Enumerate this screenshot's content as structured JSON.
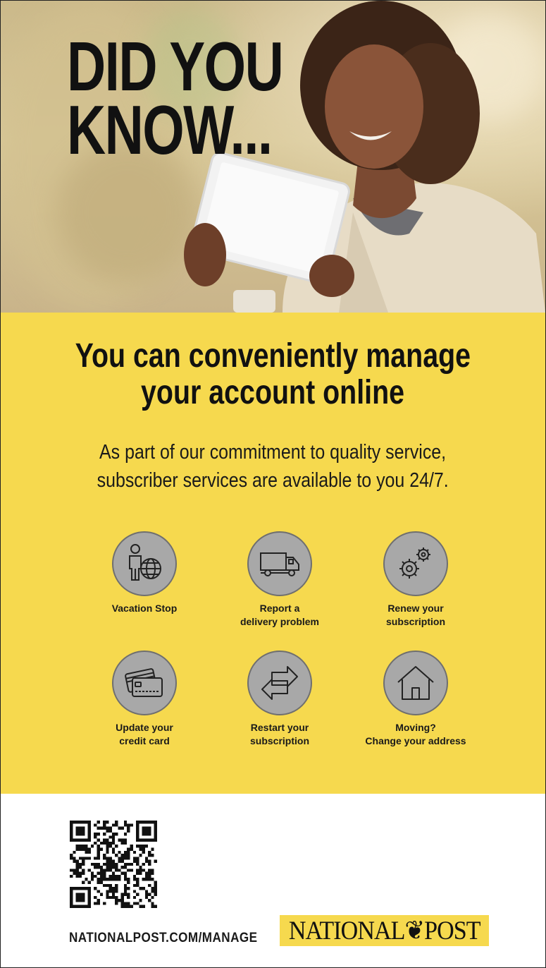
{
  "hero": {
    "title_line1": "DID YOU",
    "title_line2": "KNOW..."
  },
  "panel": {
    "headline_line1": "You can conveniently manage",
    "headline_line2": "your account online",
    "subhead_line1": "As part of our commitment to quality service,",
    "subhead_line2": "subscriber services are available to you 24/7.",
    "services": [
      {
        "icon": "person-globe-icon",
        "label_line1": "Vacation Stop",
        "label_line2": ""
      },
      {
        "icon": "delivery-truck-icon",
        "label_line1": "Report a",
        "label_line2": "delivery problem"
      },
      {
        "icon": "gears-icon",
        "label_line1": "Renew your",
        "label_line2": "subscription"
      },
      {
        "icon": "credit-card-icon",
        "label_line1": "Update your",
        "label_line2": "credit card"
      },
      {
        "icon": "arrows-exchange-icon",
        "label_line1": "Restart your",
        "label_line2": "subscription"
      },
      {
        "icon": "house-icon",
        "label_line1": "Moving?",
        "label_line2": "Change your address"
      }
    ]
  },
  "footer": {
    "url": "NATIONALPOST.COM/MANAGE",
    "logo_text": "NATIONAL❦POST"
  },
  "colors": {
    "accent_yellow": "#f6d94e",
    "icon_circle": "#a8a8a8",
    "text": "#111111"
  }
}
